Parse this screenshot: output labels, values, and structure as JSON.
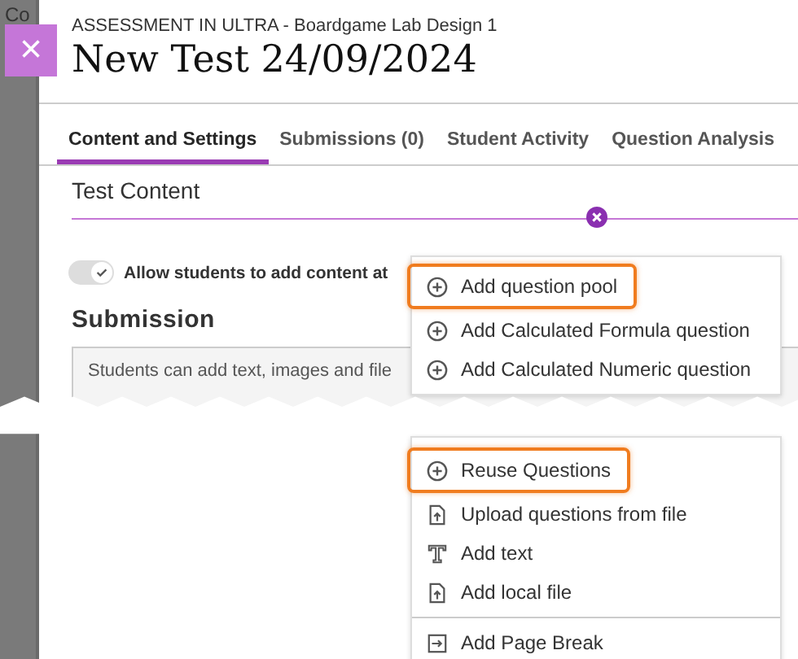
{
  "background_page": {
    "text": "Co"
  },
  "close_button": {
    "label": "×"
  },
  "header": {
    "breadcrumb": "ASSESSMENT IN ULTRA - Boardgame Lab Design 1",
    "title": "New Test 24/09/2024"
  },
  "tabs": [
    {
      "label": "Content and Settings",
      "selected": true
    },
    {
      "label": "Submissions (0)",
      "selected": false
    },
    {
      "label": "Student Activity",
      "selected": false
    },
    {
      "label": "Question Analysis",
      "selected": false
    }
  ],
  "section_title": "Test Content",
  "toggle": {
    "label": "Allow students to add content at",
    "on": true
  },
  "submission": {
    "heading": "Submission",
    "placeholder": "Students can add text, images and file"
  },
  "menu_upper": [
    {
      "kind": "add",
      "label": "Add question pool",
      "highlighted": true,
      "divided": false
    },
    {
      "kind": "add",
      "label": "Add Calculated Formula question",
      "highlighted": false,
      "divided": false
    },
    {
      "kind": "add",
      "label": "Add Calculated Numeric question",
      "highlighted": false,
      "divided": false
    }
  ],
  "menu_lower": [
    {
      "kind": "add",
      "label": "Reuse Questions",
      "highlighted": true,
      "divided": false
    },
    {
      "kind": "upload",
      "label": "Upload questions from file",
      "highlighted": false,
      "divided": false
    },
    {
      "kind": "text",
      "label": "Add text",
      "highlighted": false,
      "divided": false
    },
    {
      "kind": "file",
      "label": "Add local file",
      "highlighted": false,
      "divided": false
    },
    {
      "kind": "pagebreak",
      "label": "Add Page Break",
      "highlighted": false,
      "divided": true
    }
  ]
}
